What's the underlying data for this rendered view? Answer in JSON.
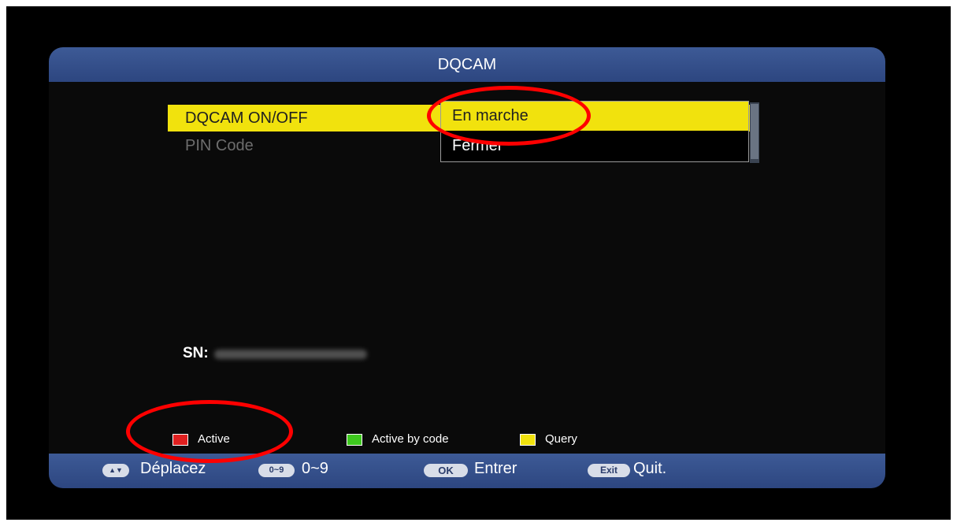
{
  "title": "DQCAM",
  "menu": {
    "items": [
      {
        "label": "DQCAM ON/OFF"
      },
      {
        "label": "PIN Code"
      }
    ]
  },
  "dropdown": {
    "options": [
      "En marche",
      "Fermer"
    ],
    "selected": "En marche"
  },
  "serial": {
    "label": "SN:"
  },
  "legend": {
    "red_label": "Active",
    "green_label": "Active by code",
    "yellow_label": "Query",
    "colors": {
      "red": "#e02020",
      "green": "#3ec81e",
      "yellow": "#f1e20d"
    }
  },
  "help": {
    "move_key": "▲▼",
    "move_label": "Déplacez",
    "num_key": "0~9",
    "num_label": "0~9",
    "ok_key": "OK",
    "ok_label": "Entrer",
    "exit_key": "Exit",
    "exit_label": "Quit."
  },
  "colors": {
    "titlebar": "#3d5a96",
    "highlight": "#f1e20d",
    "annotation": "#ff0000"
  }
}
